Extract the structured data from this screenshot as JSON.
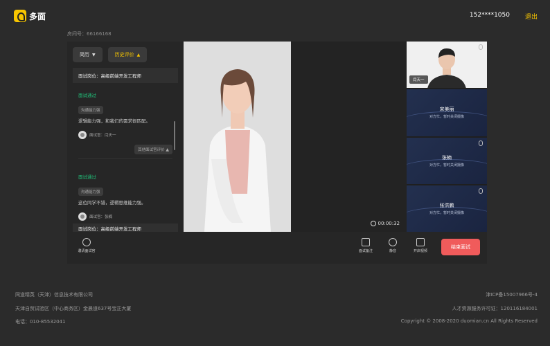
{
  "header": {
    "logo_text": "多面",
    "user_phone": "152****1050",
    "logout": "退出"
  },
  "room_id": "房间号：66166168",
  "panel": {
    "tabs": [
      {
        "label": "简历",
        "active": false
      },
      {
        "label": "历史评价",
        "active": true
      }
    ],
    "position_title": "面试岗位：高级前端开发工程师",
    "evaluations": [
      {
        "status": "面试通过",
        "tag": "沟通能力强",
        "comment": "逻辑能力强，和我们的需求很匹配。",
        "interviewer": "面试官：闫天一",
        "more": "其他面试官评价"
      },
      {
        "status": "面试通过",
        "tag": "沟通能力强",
        "comment": "这位同学不错，逻辑思维能力强。",
        "interviewer": "面试官：张楠"
      }
    ],
    "footer_title": "面试岗位：高级前端开发工程师"
  },
  "timer": "00:00:32",
  "tiles": [
    {
      "type": "video",
      "name": "闫天一"
    },
    {
      "type": "audio",
      "name": "宋美丽",
      "sub": "对方忙，暂时关闭摄像"
    },
    {
      "type": "audio",
      "name": "张楠",
      "sub": "对方忙，暂时关闭摄像"
    },
    {
      "type": "audio",
      "name": "张洪鹏",
      "sub": "对方忙，暂时关闭摄像"
    }
  ],
  "toolbar": {
    "invite": "邀请面试官",
    "notes": "面试备注",
    "mute": "静音",
    "camera": "开启视频",
    "end": "结束面试"
  },
  "footer": {
    "company": "同道精英（天津）信息技术有限公司",
    "address": "天津自贸试验区（中心商务区）金晨道637号宝正大厦",
    "phone": "电话：010-85532041",
    "icp": "津ICP备15007966号-4",
    "license": "人才资源服务许可证：120116184001",
    "copyright": "Copyright © 2008-2020 duomian.cn All Rights Reserved"
  },
  "colors": {
    "accent": "#f7c500",
    "success": "#20c27a",
    "danger": "#f05b5b",
    "background": "#2b2b2b"
  }
}
